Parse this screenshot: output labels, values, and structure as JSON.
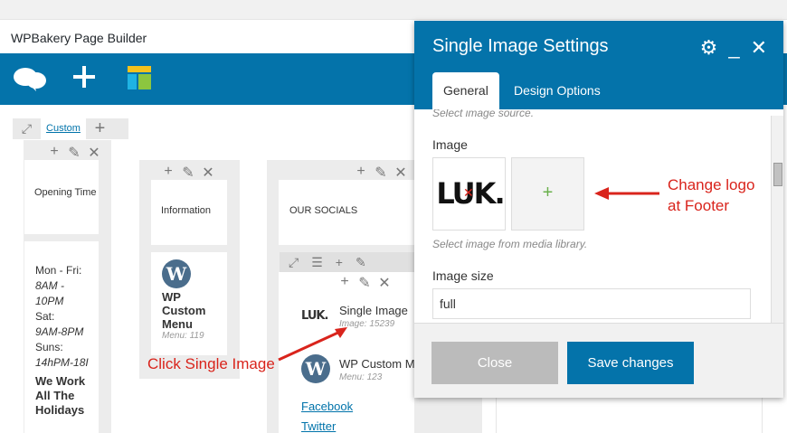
{
  "builder": {
    "title": "WPBakery Page Builder"
  },
  "toolbar": {
    "icons": [
      "wpbakery-logo-icon",
      "add-element-icon",
      "templates-icon"
    ]
  },
  "row": {
    "custom_label": "Custom"
  },
  "columns": [
    {
      "title": "Opening Time",
      "hours": [
        "Mon - Fri:",
        "8AM -",
        "10PM",
        "Sat:",
        "9AM-8PM",
        "Suns:",
        "14hPM-18I"
      ],
      "note": "We Work All The Holidays"
    },
    {
      "title": "Information",
      "menu_title": "WP Custom Menu",
      "menu_sub": "Menu: 119"
    },
    {
      "title": "OUR SOCIALS",
      "image_title": "Single Image",
      "image_sub": "Image: 15239",
      "menu_title": "WP Custom M",
      "menu_sub": "Menu: 123",
      "links": [
        "Facebook",
        "Twitter"
      ]
    }
  ],
  "annotations": {
    "click_single_image": "Click Single Image",
    "change_logo": "Change logo at Footer"
  },
  "modal": {
    "title": "Single Image Settings",
    "tabs": [
      "General",
      "Design Options"
    ],
    "cut_hint": "Select image source.",
    "image_label": "Image",
    "image_preview_text": "LUK.",
    "add_symbol": "+",
    "image_hint": "Select image from media library.",
    "size_label": "Image size",
    "size_value": "full",
    "close_label": "Close",
    "save_label": "Save changes"
  },
  "colors": {
    "accent": "#0473aa",
    "annotation": "#d9241c",
    "close_btn": "#bbbbbb"
  }
}
